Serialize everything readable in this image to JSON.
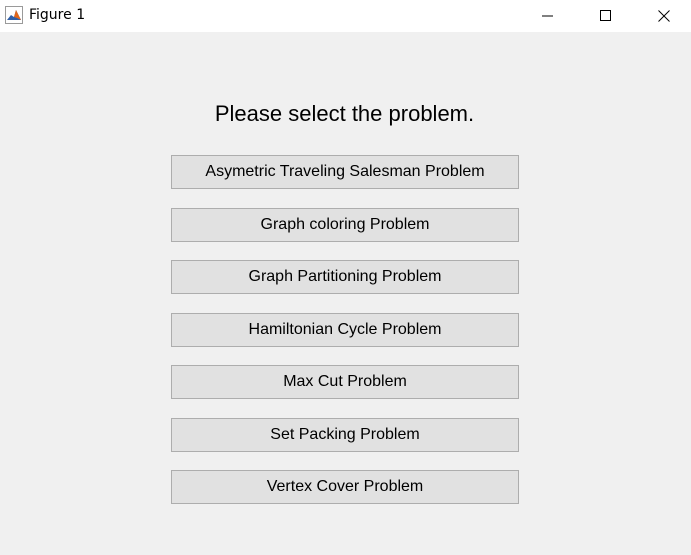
{
  "window": {
    "title": "Figure 1",
    "app_icon": "matlab-icon",
    "controls": [
      "minimize-icon",
      "maximize-icon",
      "close-icon"
    ]
  },
  "main": {
    "prompt": "Please select the problem.",
    "buttons": [
      "Asymetric Traveling Salesman Problem",
      "Graph coloring Problem",
      "Graph Partitioning Problem",
      "Hamiltonian Cycle Problem",
      "Max Cut Problem",
      "Set Packing Problem",
      "Vertex Cover Problem"
    ]
  },
  "colors": {
    "background": "#f0f0f0",
    "titlebar": "#ffffff",
    "button_face": "#e1e1e1",
    "button_border": "#adadad"
  }
}
